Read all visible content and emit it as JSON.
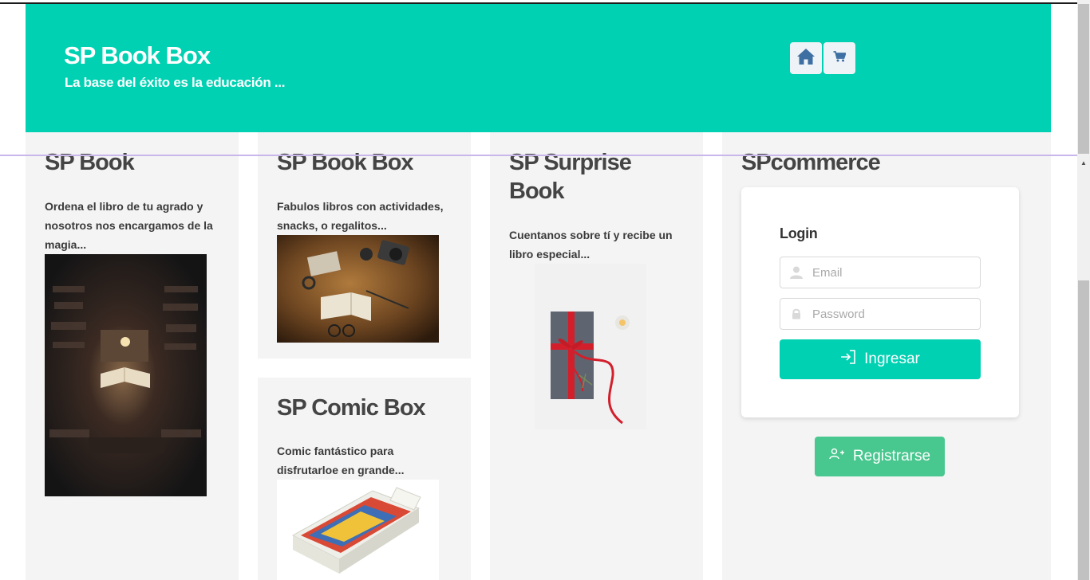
{
  "header": {
    "title": "SP Book Box",
    "subtitle": "La base del éxito es la educación ...",
    "icons": [
      "home-icon",
      "cart-icon"
    ]
  },
  "columns": [
    {
      "title": "SP Book",
      "text": "Ordena el libro de tu agrado y nosotros nos encargamos de la magia..."
    },
    {
      "title": "SP Book Box",
      "text": "Fabulos libros con actividades, snacks, o regalitos..."
    },
    {
      "title": "SP Comic Box",
      "text": "Comic fantástico para disfrutarloe en grande..."
    },
    {
      "title": "SP Surprise Book",
      "text": "Cuentanos sobre tí y recibe un libro especial..."
    },
    {
      "title": "SPcommerce"
    }
  ],
  "login": {
    "title": "Login",
    "email_placeholder": "Email",
    "password_placeholder": "Password",
    "submit_label": "Ingresar"
  },
  "register_label": "Registrarse",
  "colors": {
    "primary": "#00d1b2",
    "success": "#48c78e",
    "panel": "#f4f4f4",
    "nav_icon": "#3e6fa3"
  }
}
